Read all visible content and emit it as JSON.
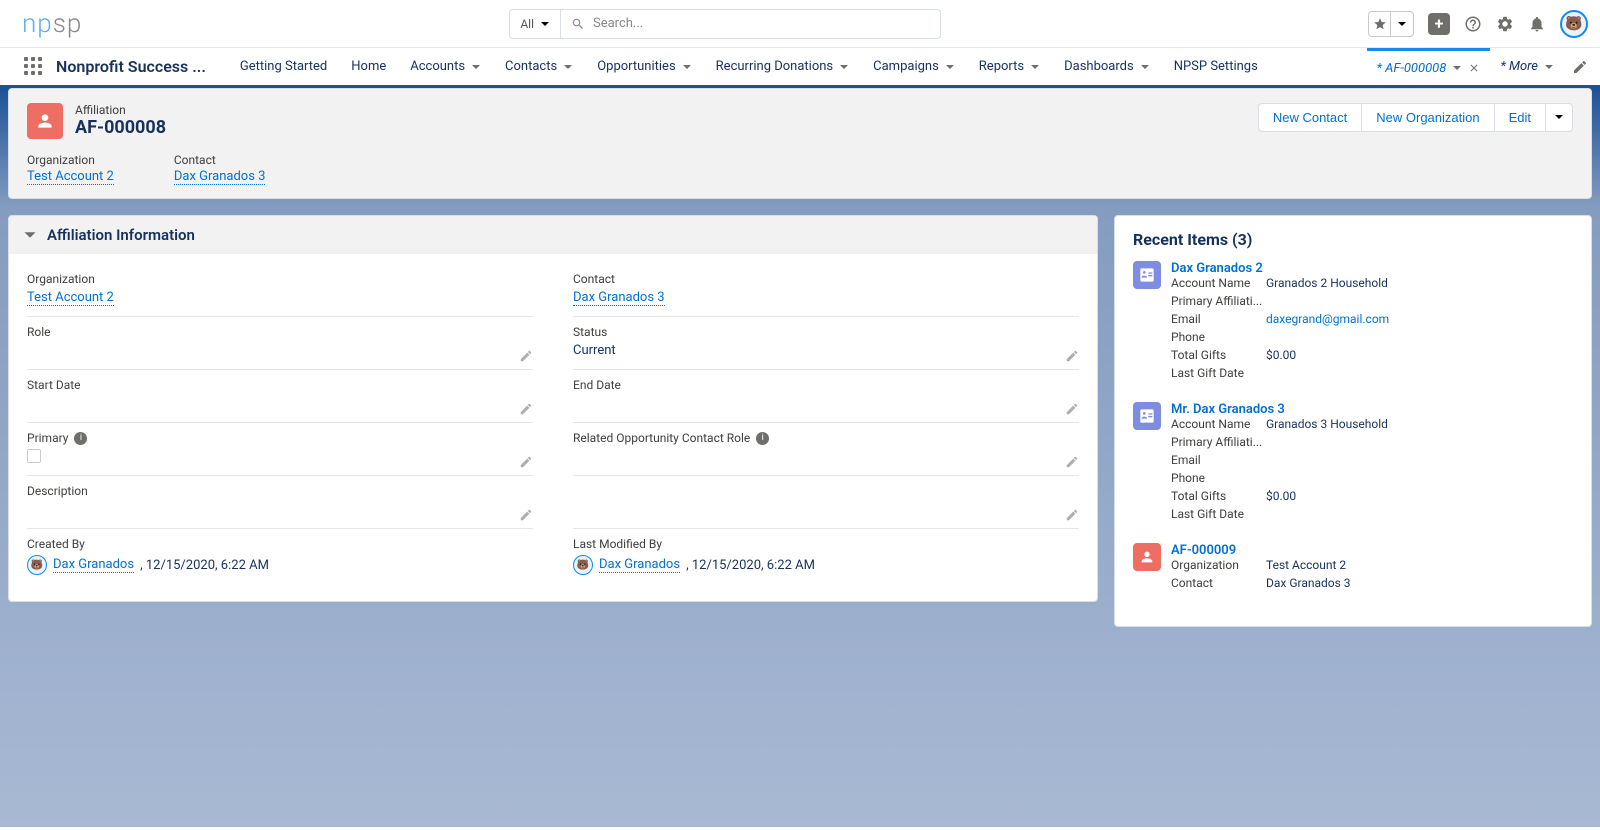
{
  "topbar": {
    "logo_tag": "np",
    "logo_rest": "sp",
    "search_filter": "All",
    "search_placeholder": "Search..."
  },
  "nav": {
    "app_name": "Nonprofit Success ...",
    "items": [
      "Getting Started",
      "Home",
      "Accounts",
      "Contacts",
      "Opportunities",
      "Recurring Donations",
      "Campaigns",
      "Reports",
      "Dashboards",
      "NPSP Settings"
    ],
    "active_tab": "* AF-000008",
    "more": "* More"
  },
  "header": {
    "type": "Affiliation",
    "name": "AF-000008",
    "actions": [
      "New Contact",
      "New Organization",
      "Edit"
    ],
    "fields": {
      "org_label": "Organization",
      "org_value": "Test Account 2",
      "contact_label": "Contact",
      "contact_value": "Dax Granados 3"
    }
  },
  "section": {
    "title": "Affiliation Information",
    "fields": {
      "organization": {
        "label": "Organization",
        "value": "Test Account 2",
        "link": true
      },
      "contact": {
        "label": "Contact",
        "value": "Dax Granados 3",
        "link": true
      },
      "role": {
        "label": "Role",
        "value": ""
      },
      "status": {
        "label": "Status",
        "value": "Current"
      },
      "start_date": {
        "label": "Start Date",
        "value": ""
      },
      "end_date": {
        "label": "End Date",
        "value": ""
      },
      "primary": {
        "label": "Primary"
      },
      "related_ocr": {
        "label": "Related Opportunity Contact Role"
      },
      "description": {
        "label": "Description",
        "value": ""
      },
      "created_by": {
        "label": "Created By",
        "user": "Dax Granados",
        "ts": ", 12/15/2020, 6:22 AM"
      },
      "modified_by": {
        "label": "Last Modified By",
        "user": "Dax Granados",
        "ts": ", 12/15/2020, 6:22 AM"
      }
    }
  },
  "recent": {
    "title": "Recent Items (3)",
    "items": [
      {
        "type": "contact",
        "name": "Dax Granados 2",
        "rows": [
          {
            "k": "Account Name",
            "v": "Granados 2 Household"
          },
          {
            "k": "Primary Affiliati...",
            "v": ""
          },
          {
            "k": "Email",
            "v": "daxegrand@gmail.com",
            "link": true
          },
          {
            "k": "Phone",
            "v": ""
          },
          {
            "k": "Total Gifts",
            "v": "$0.00"
          },
          {
            "k": "Last Gift Date",
            "v": ""
          }
        ]
      },
      {
        "type": "contact",
        "name": "Mr. Dax Granados 3",
        "rows": [
          {
            "k": "Account Name",
            "v": "Granados 3 Household"
          },
          {
            "k": "Primary Affiliati...",
            "v": ""
          },
          {
            "k": "Email",
            "v": ""
          },
          {
            "k": "Phone",
            "v": ""
          },
          {
            "k": "Total Gifts",
            "v": "$0.00"
          },
          {
            "k": "Last Gift Date",
            "v": ""
          }
        ]
      },
      {
        "type": "affil",
        "name": "AF-000009",
        "rows": [
          {
            "k": "Organization",
            "v": "Test Account 2"
          },
          {
            "k": "Contact",
            "v": "Dax Granados 3"
          }
        ]
      }
    ]
  }
}
